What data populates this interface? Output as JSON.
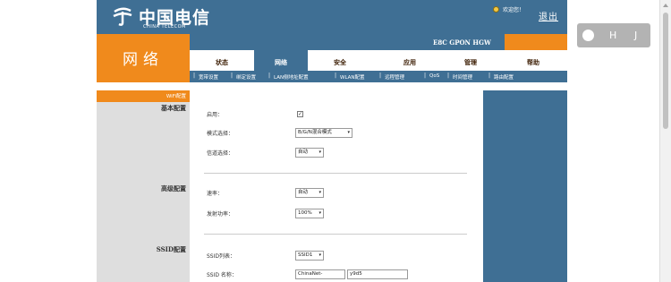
{
  "header": {
    "brand_cn": "中国电信",
    "brand_en": "CHINA TELECOM",
    "welcome": "欢迎您！",
    "exit": "退出",
    "model": "E8C GPON HGW"
  },
  "section_title": "网络",
  "tabs": [
    "状态",
    "网络",
    "安全",
    "应用",
    "管理",
    "帮助"
  ],
  "active_tab_index": 1,
  "subnav": [
    "宽带设置",
    "绑定设置",
    "LAN侧地址配置",
    "WLAN配置",
    "远程管理",
    "QoS",
    "时间管理",
    "路由配置"
  ],
  "sidebar": {
    "highlight": "WiFi配置",
    "basic": "基本配置",
    "advanced": "高级配置",
    "ssid": "SSID配置"
  },
  "form": {
    "enable_label": "启用：",
    "enable_checked": true,
    "mode_label": "模式选择：",
    "mode_value": "B/G/N混合模式",
    "channel_label": "信道选择：",
    "channel_value": "自动",
    "rate_label": "速率：",
    "rate_value": "自动",
    "power_label": "发射功率：",
    "power_value": "100%",
    "ssid_list_label": "SSID列表：",
    "ssid_list_value": "SSID1",
    "ssid_name_label": "SSID 名称：",
    "ssid_name_prefix": "ChinaNet-",
    "ssid_name_value": "y9d5"
  },
  "toolbar": {
    "h": "H",
    "j": "J"
  },
  "colors": {
    "accent_orange": "#f08a1c",
    "header_blue": "#3f6f94"
  }
}
